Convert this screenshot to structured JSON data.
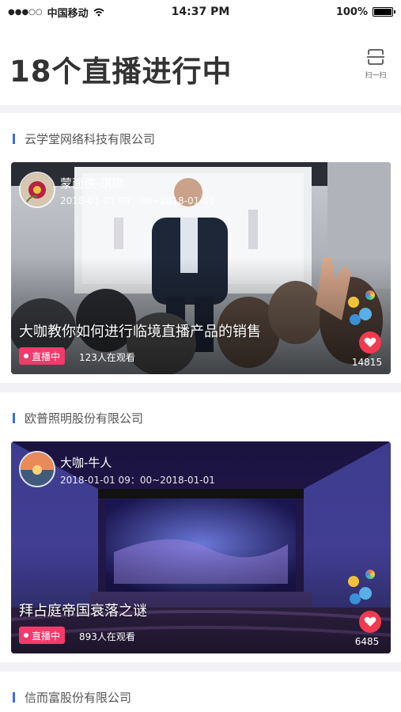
{
  "status_bar": {
    "carrier": "中国移动",
    "time": "14:37 PM",
    "battery": "100%"
  },
  "header": {
    "title": "18个直播进行中",
    "scan_label": "扫一扫"
  },
  "sections": [
    {
      "company": "云学堂网络科技有限公司",
      "host": "蒙面侠-琪琪",
      "time": "2018-01-01 09：00~2018-01-01",
      "title": "大咖教你如何进行临境直播产品的销售",
      "badge": "直播中",
      "viewers": "123人在观看",
      "likes": "14815"
    },
    {
      "company": "欧普照明股份有限公司",
      "host": "大咖-牛人",
      "time": "2018-01-01 09：00~2018-01-01",
      "title": "拜占庭帝国衰落之谜",
      "badge": "直播中",
      "viewers": "893人在观看",
      "likes": "6485"
    },
    {
      "company": "信而富股份有限公司"
    }
  ],
  "colors": {
    "live_badge": "#f23a6b",
    "heart": "#f23a50",
    "section_bar": "#3c6edb"
  }
}
